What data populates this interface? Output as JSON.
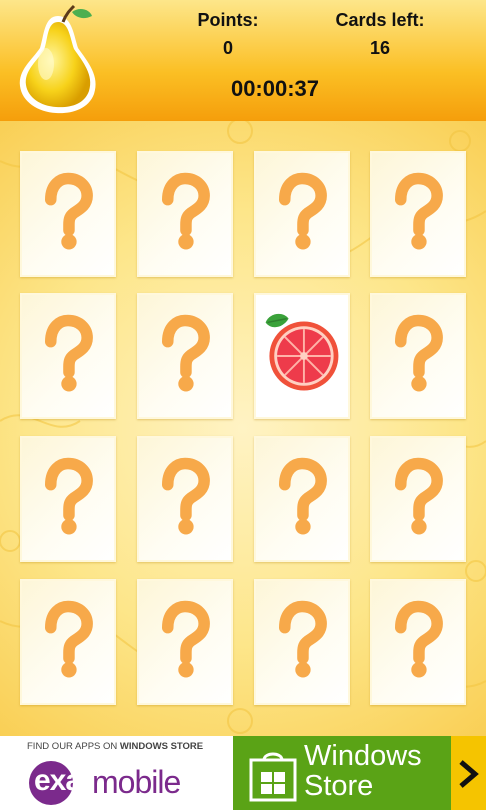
{
  "header": {
    "points_label": "Points:",
    "points_value": "0",
    "cards_left_label": "Cards left:",
    "cards_left_value": "16",
    "timer": "00:00:37",
    "logo_icon": "pear-icon"
  },
  "board": {
    "rows": 4,
    "cols": 4,
    "cards": [
      {
        "state": "hidden",
        "icon": "question-mark-icon"
      },
      {
        "state": "hidden",
        "icon": "question-mark-icon"
      },
      {
        "state": "hidden",
        "icon": "question-mark-icon"
      },
      {
        "state": "hidden",
        "icon": "question-mark-icon"
      },
      {
        "state": "hidden",
        "icon": "question-mark-icon"
      },
      {
        "state": "hidden",
        "icon": "question-mark-icon"
      },
      {
        "state": "revealed",
        "icon": "grapefruit-icon"
      },
      {
        "state": "hidden",
        "icon": "question-mark-icon"
      },
      {
        "state": "hidden",
        "icon": "question-mark-icon"
      },
      {
        "state": "hidden",
        "icon": "question-mark-icon"
      },
      {
        "state": "hidden",
        "icon": "question-mark-icon"
      },
      {
        "state": "hidden",
        "icon": "question-mark-icon"
      },
      {
        "state": "hidden",
        "icon": "question-mark-icon"
      },
      {
        "state": "hidden",
        "icon": "question-mark-icon"
      },
      {
        "state": "hidden",
        "icon": "question-mark-icon"
      },
      {
        "state": "hidden",
        "icon": "question-mark-icon"
      }
    ]
  },
  "ad": {
    "find_prefix": "FIND OUR APPS ON ",
    "find_store": "WINDOWS STORE",
    "brand_exa": "exa",
    "brand_mobile": "mobile",
    "store_line1": "Windows",
    "store_line2": "Store",
    "store_icon": "windows-store-bag-icon",
    "arrow_icon": "chevron-right-icon"
  },
  "colors": {
    "header_gold": "#fbbf24",
    "question_orange": "#f7a94a",
    "exa_purple": "#7b2a8c",
    "store_green": "#5aa316",
    "arrow_yellow": "#f5c400"
  }
}
